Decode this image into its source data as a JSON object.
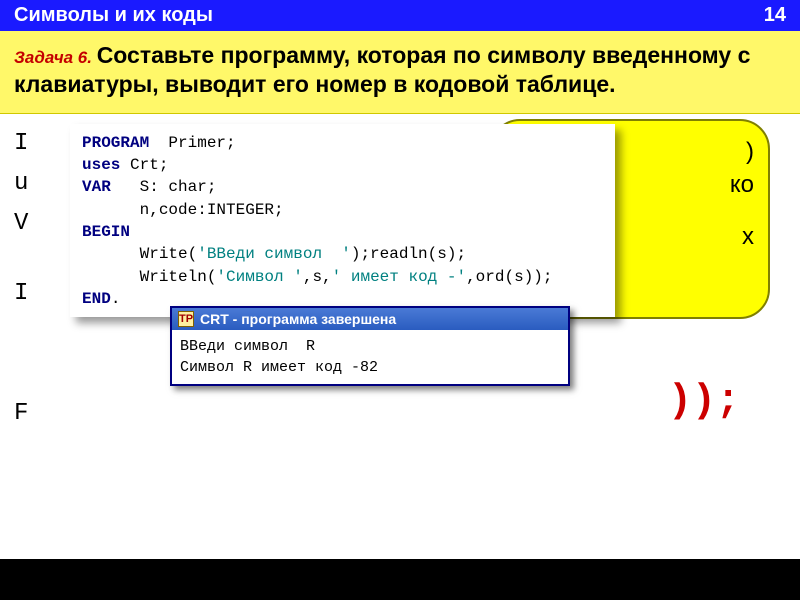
{
  "header": {
    "title": "Символы  и их коды",
    "page_num": "14"
  },
  "task": {
    "label": "Задача 6. ",
    "text": "Составьте программу, которая по символу введенному с клавиатуры, выводит его номер в кодовой таблице."
  },
  "bubble": {
    "line1": ")",
    "line2": "ко",
    "line3": "х"
  },
  "bg_left": {
    "l1": "I",
    "l2": "u",
    "l3": "V",
    "l4": "I",
    "l5": "F"
  },
  "red_frag": "));",
  "ide": {
    "l1_kw": "PROGRAM",
    "l1_rest": "  Primer;",
    "l2_kw": "uses",
    "l2_rest": " Crt;",
    "l3_kw": "VAR",
    "l3_rest": "   S: char;",
    "l4": "      n,code:INTEGER;",
    "l5_kw": "BEGIN",
    "l6a": "      Write(",
    "l6s": "'ВВеди символ  '",
    "l6b": ");readln(s);",
    "l7a": "      Writeln(",
    "l7s1": "'Символ '",
    "l7b": ",s,",
    "l7s2": "' имеет код -'",
    "l7c": ",ord(s));",
    "l8_kw": "END",
    "l8_rest": "."
  },
  "crt": {
    "icon_glyph": "TP",
    "title": "CRT - программа завершена",
    "out1": "ВВеди символ  R",
    "out2": "Символ R имеет код -82"
  }
}
